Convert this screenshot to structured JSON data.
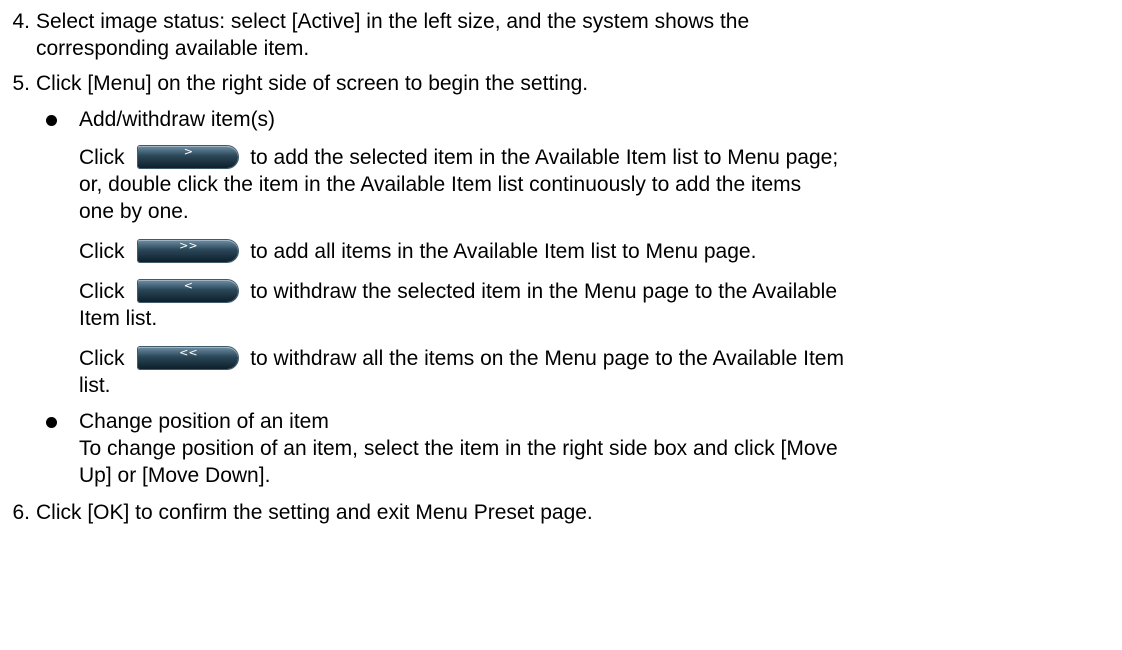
{
  "steps": {
    "s4": {
      "num": "4.",
      "line1": "Select image status: select [Active] in the left size, and the system shows the",
      "line2": "corresponding available item."
    },
    "s5": {
      "num": "5.",
      "text": "Click [Menu] on the right side of screen to begin the setting."
    },
    "s6": {
      "num": "6.",
      "text": "Click [OK] to confirm the setting and exit Menu Preset page."
    }
  },
  "add_withdraw": {
    "heading": "Add/withdraw item(s)",
    "add_one": {
      "click": "Click",
      "button": ">",
      "rest1": "to add the selected item in the Available Item list to Menu page;",
      "line2": "or, double click the item in the Available Item list continuously to add the items",
      "line3": "one by one."
    },
    "add_all": {
      "click": "Click",
      "button": ">>",
      "rest1": "to add all items in the Available Item list to Menu page."
    },
    "remove_one": {
      "click": "Click",
      "button": "<",
      "rest1": "to withdraw the selected item in the Menu page to the Available",
      "line2": "Item list."
    },
    "remove_all": {
      "click": "Click",
      "button": "<<",
      "rest1": "to withdraw all the items on the Menu page to the Available Item",
      "line2": "list."
    }
  },
  "change_position": {
    "heading": "Change position of an item",
    "line1": "To change position of an item, select the item in the right side box and click [Move",
    "line2": "Up] or [Move Down]."
  },
  "icons": {
    "bullet": "bullet-dot-icon"
  },
  "colors": {
    "text": "#000000",
    "button_top": "#6f8fa6",
    "button_bottom": "#0e1f2b",
    "button_glyph": "#ffffff"
  }
}
